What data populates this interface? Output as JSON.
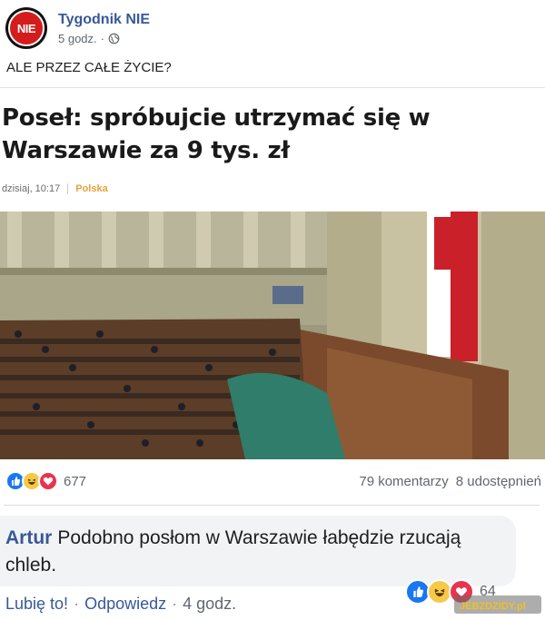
{
  "post": {
    "page_name": "Tygodnik NIE",
    "avatar_logo": "NIE",
    "time": "5 godz.",
    "meta_separator": "·",
    "privacy_icon": "globe-icon",
    "text": "ALE PRZEZ CAŁE ŻYCIE?"
  },
  "article": {
    "title": "Poseł: spróbujcie utrzymać się w Warszawie za 9 tys. zł",
    "date": "dzisiaj, 10:17",
    "category": "Polska",
    "photo_icon": "parliament-photo"
  },
  "stats": {
    "reaction_icons": [
      "like-icon",
      "haha-icon",
      "love-icon"
    ],
    "reaction_count": "677",
    "comments": "79 komentarzy",
    "shares": "8 udostępnień"
  },
  "comment": {
    "author": "Artur",
    "text": "Podobno posłom w Warszawie łabędzie rzucają chleb.",
    "reaction_icons": [
      "like-icon",
      "haha-icon",
      "love-icon"
    ],
    "reaction_count": "64",
    "like_label": "Lubię to!",
    "reply_label": "Odpowiedz",
    "time": "4 godz.",
    "separator": "·"
  },
  "watermark": {
    "text": "JEBZDZIDY.pl"
  },
  "colors": {
    "link_blue": "#385898",
    "like_blue": "#1877f2",
    "haha_yellow": "#f7c948",
    "love_red": "#e8344e",
    "category_orange": "#e8a33a"
  }
}
